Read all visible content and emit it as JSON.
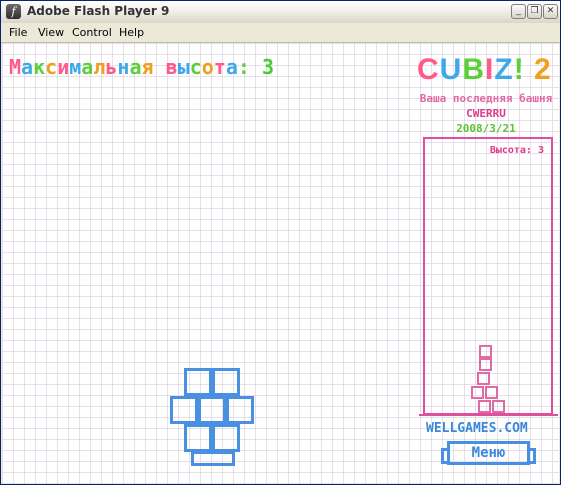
{
  "window": {
    "title": "Adobe Flash Player 9",
    "controls": [
      "minimize",
      "restore",
      "close"
    ]
  },
  "menu": {
    "items": [
      "File",
      "View",
      "Control",
      "Help"
    ]
  },
  "game": {
    "max_height_label": "Максимальная высота:",
    "max_height_value": "3",
    "logo_letters": [
      "C",
      "U",
      "B",
      "I",
      "Z",
      "!",
      " ",
      "2"
    ],
    "logo_colors": [
      "#ff5a8a",
      "#3ea8e8",
      "#5ccf3a",
      "#ff5a8a",
      "#3ea8e8",
      "#5ccf3a",
      "",
      "#f0a020"
    ],
    "last_tower_label": "Ваша последняя башня",
    "user_name": "CWERRU",
    "date": "2008/3/21",
    "tower_height_label": "Высота: 3",
    "site": "WELLGAMES.COM",
    "menu_button": "Меню",
    "colors": {
      "pink": "#e04f9f",
      "blue": "#4a90e2",
      "green": "#44cc33"
    }
  }
}
